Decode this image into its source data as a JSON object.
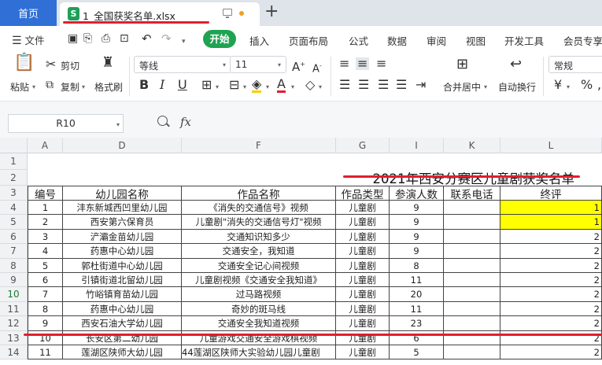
{
  "tabs": {
    "home": "首页",
    "file": "1_全国获奖名单.xlsx",
    "new_tab": "+"
  },
  "menu": {
    "file": "文件",
    "items": [
      "开始",
      "插入",
      "页面布局",
      "公式",
      "数据",
      "审阅",
      "视图",
      "开发工具",
      "会员专享"
    ]
  },
  "ribbon": {
    "cut": "剪切",
    "paste": "粘贴",
    "copy": "复制",
    "format_painter": "格式刷",
    "font_name": "等线",
    "font_size": "11",
    "merge": "合并居中",
    "wrap": "自动换行",
    "number_format": "常规",
    "currency": "¥",
    "percent": "%"
  },
  "formula_bar": {
    "name_box": "R10",
    "fx": "fx",
    "formula": ""
  },
  "columns": [
    "A",
    "D",
    "F",
    "G",
    "I",
    "K",
    "L"
  ],
  "row_numbers": [
    "1",
    "2",
    "3",
    "4",
    "5",
    "6",
    "7",
    "8",
    "9",
    "10",
    "11",
    "12",
    "13",
    "14"
  ],
  "sheet_title": "2021年西安分赛区儿童剧获奖名单",
  "table_headers": [
    "编号",
    "幼儿园名称",
    "作品名称",
    "作品类型",
    "参演人数",
    "联系电话",
    "终评"
  ],
  "rows": [
    [
      "1",
      "沣东新城西凹里幼儿园",
      "《消失的交通信号》视频",
      "儿童剧",
      "9",
      "",
      "1"
    ],
    [
      "2",
      "西安第六保育员",
      "儿童剧\"消失的交通信号灯\"视频",
      "儿童剧",
      "9",
      "",
      "1"
    ],
    [
      "3",
      "浐灞金苗幼儿园",
      "交通知识知多少",
      "儿童剧",
      "9",
      "",
      "2"
    ],
    [
      "4",
      "药惠中心幼儿园",
      "交通安全，我知道",
      "儿童剧",
      "9",
      "",
      "2"
    ],
    [
      "5",
      "郭杜街道中心幼儿园",
      "交通安全记心间视频",
      "儿童剧",
      "8",
      "",
      "2"
    ],
    [
      "6",
      "引镇街道北留幼儿园",
      "儿童剧视频《交通安全我知道》",
      "儿童剧",
      "11",
      "",
      "2"
    ],
    [
      "7",
      "竹峪镇育苗幼儿园",
      "过马路视频",
      "儿童剧",
      "20",
      "",
      "2"
    ],
    [
      "8",
      "药惠中心幼儿园",
      "奇妙的斑马线",
      "儿童剧",
      "11",
      "",
      "2"
    ],
    [
      "9",
      "西安石油大学幼儿园",
      "交通安全我知道视频",
      "儿童剧",
      "23",
      "",
      "2"
    ],
    [
      "10",
      "长安区第二幼儿园",
      "儿童游戏交通安全游戏棋视频",
      "儿童剧",
      "6",
      "",
      "2"
    ],
    [
      "11",
      "莲湖区陕师大幼儿园",
      "44莲湖区陕师大实验幼儿园儿童剧",
      "儿童剧",
      "5",
      "",
      "2"
    ]
  ],
  "highlight_color": "#ffff00",
  "accent_color": "#1fa353",
  "annotation_color": "#e01f2e"
}
